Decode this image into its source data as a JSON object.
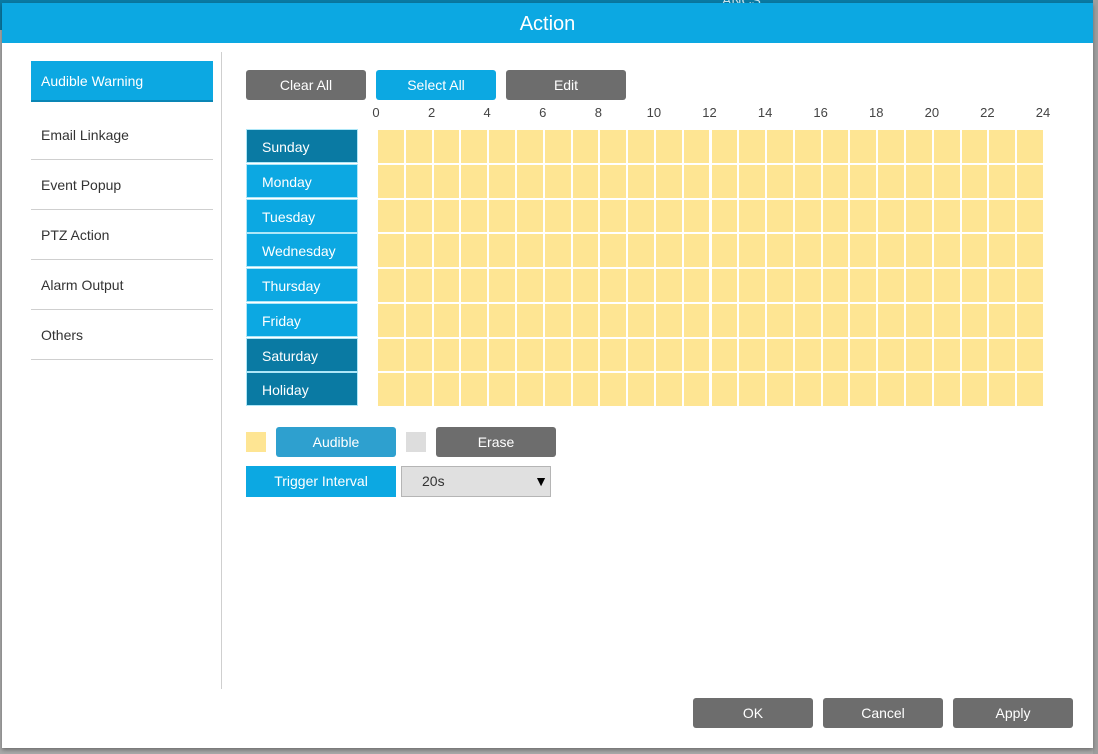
{
  "background": {
    "partial_text": "ANCS"
  },
  "dialog": {
    "title": "Action"
  },
  "sidebar": {
    "items": [
      {
        "label": "Audible Warning",
        "active": true
      },
      {
        "label": "Email Linkage",
        "active": false
      },
      {
        "label": "Event Popup",
        "active": false
      },
      {
        "label": "PTZ Action",
        "active": false
      },
      {
        "label": "Alarm Output",
        "active": false
      },
      {
        "label": "Others",
        "active": false
      }
    ]
  },
  "toolbar": {
    "clear_all": "Clear All",
    "select_all": "Select All",
    "edit": "Edit"
  },
  "schedule": {
    "hour_labels": [
      "0",
      "2",
      "4",
      "6",
      "8",
      "10",
      "12",
      "14",
      "16",
      "18",
      "20",
      "22",
      "24"
    ],
    "days": [
      {
        "label": "Sunday",
        "shade": "dark"
      },
      {
        "label": "Monday",
        "shade": "light"
      },
      {
        "label": "Tuesday",
        "shade": "light"
      },
      {
        "label": "Wednesday",
        "shade": "light"
      },
      {
        "label": "Thursday",
        "shade": "light"
      },
      {
        "label": "Friday",
        "shade": "light"
      },
      {
        "label": "Saturday",
        "shade": "dark"
      },
      {
        "label": "Holiday",
        "shade": "dark"
      }
    ],
    "slots_per_day": 24,
    "all_slots_selected": true,
    "selected_color": "#fee593"
  },
  "legend": {
    "audible_label": "Audible",
    "audible_color": "#fee593",
    "erase_label": "Erase",
    "erase_color": "#dddddd"
  },
  "trigger_interval": {
    "label": "Trigger Interval",
    "value": "20s"
  },
  "footer": {
    "ok": "OK",
    "cancel": "Cancel",
    "apply": "Apply"
  },
  "colors": {
    "accent": "#0ca8e2",
    "accent_dark": "#0a7aa3",
    "button_gray": "#6d6d6d"
  }
}
